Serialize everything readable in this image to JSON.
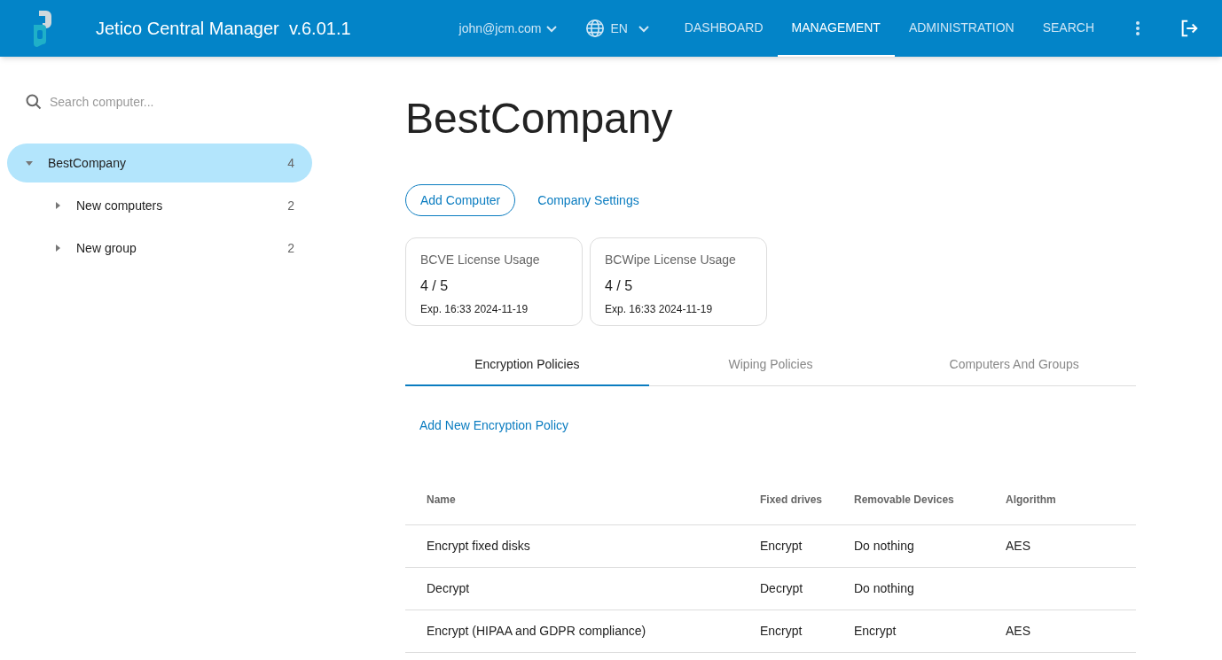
{
  "header": {
    "title": "Jetico Central Manager  v.6.01.1",
    "user": "john@jcm.com",
    "language": "EN",
    "nav": [
      {
        "label": "DASHBOARD",
        "selected": false
      },
      {
        "label": "MANAGEMENT",
        "selected": true
      },
      {
        "label": "ADMINISTRATION",
        "selected": false
      },
      {
        "label": "SEARCH",
        "selected": false
      }
    ]
  },
  "sidebar": {
    "search": {
      "placeholder": "Search computer..."
    },
    "tree": [
      {
        "label": "BestCompany",
        "count": "4",
        "selected": true,
        "expanded": true,
        "children": [
          {
            "label": "New computers",
            "count": "2",
            "selected": false,
            "expanded": false
          },
          {
            "label": "New group",
            "count": "2",
            "selected": false,
            "expanded": false
          }
        ]
      }
    ]
  },
  "main": {
    "title": "BestCompany",
    "buttons": [
      {
        "label": "Add Computer",
        "kind": "outlined"
      },
      {
        "label": "Company Settings",
        "kind": "text"
      }
    ],
    "licenses": [
      {
        "title": "BCVE License Usage",
        "usage": "4 / 5",
        "expiry": "Exp. 16:33 2024-11-19"
      },
      {
        "title": "BCWipe License Usage",
        "usage": "4 / 5",
        "expiry": "Exp. 16:33 2024-11-19"
      }
    ],
    "tabs": [
      {
        "label": "Encryption Policies",
        "selected": true
      },
      {
        "label": "Wiping Policies",
        "selected": false
      },
      {
        "label": "Computers And Groups",
        "selected": false
      }
    ],
    "add_link": "Add New Encryption Policy",
    "table": {
      "columns": [
        "Name",
        "Fixed drives",
        "Removable Devices",
        "Algorithm"
      ],
      "rows": [
        [
          "Encrypt fixed disks",
          "Encrypt",
          "Do nothing",
          "AES"
        ],
        [
          "Decrypt",
          "Decrypt",
          "Do nothing",
          ""
        ],
        [
          "Encrypt (HIPAA and GDPR compliance)",
          "Encrypt",
          "Encrypt",
          "AES"
        ]
      ]
    }
  }
}
